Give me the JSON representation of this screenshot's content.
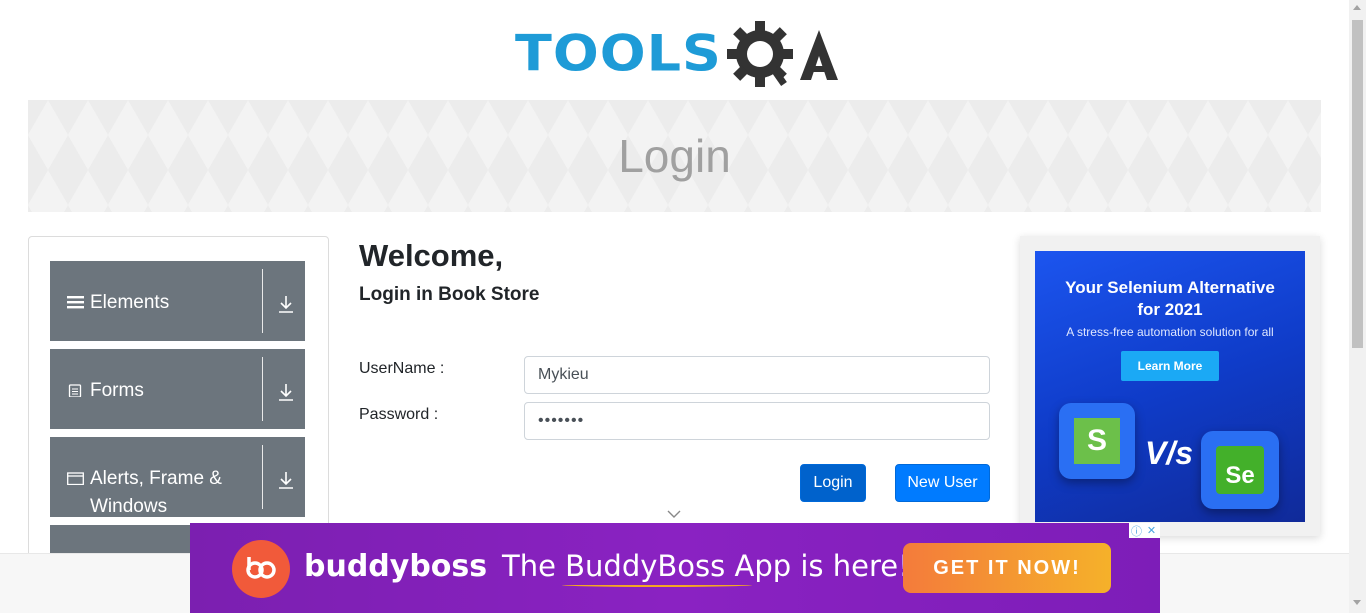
{
  "header": {
    "logo_text": "TOOLSQA",
    "logo_tools": "TOOLS",
    "logo_qa": "QA"
  },
  "banner": {
    "title": "Login"
  },
  "sidebar": {
    "groups": [
      {
        "label": "Elements",
        "icon": "hamburger-icon"
      },
      {
        "label": "Forms",
        "icon": "document-icon"
      },
      {
        "label": "Alerts, Frame & Windows",
        "icon": "window-icon"
      }
    ]
  },
  "form": {
    "welcome": "Welcome,",
    "subtitle": "Login in Book Store",
    "username_label": "UserName :",
    "username_value": "Mykieu",
    "password_label": "Password :",
    "password_value": "•••••••",
    "login_button": "Login",
    "new_user_button": "New User"
  },
  "side_ad": {
    "headline": "Your Selenium Alternative for 2021",
    "subtext": "A stress-free automation solution for all",
    "cta": "Learn More",
    "vs_text": "V/s",
    "left_logo": "S",
    "right_logo": "Se"
  },
  "bottom_ad": {
    "brand": "buddyboss",
    "tagline": "The BuddyBoss App is here!",
    "cta": "GET IT NOW!",
    "adchoices": "ⓘ",
    "close": "✕"
  },
  "colors": {
    "brand_blue": "#1e9bd7",
    "primary_button": "#007bff",
    "sidebar_group": "#6c757d",
    "ad_purple": "#7b1fb0"
  }
}
